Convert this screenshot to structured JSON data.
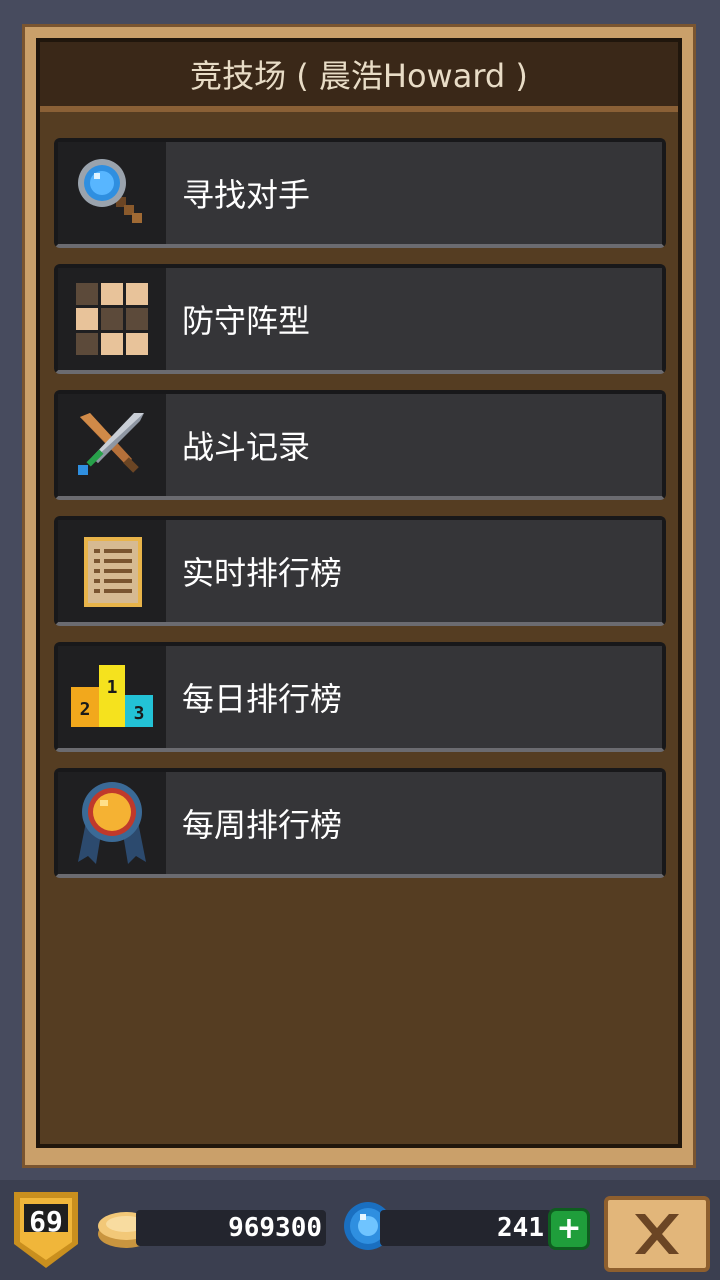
{
  "header": {
    "title": "竞技场 ( 晨浩Howard )"
  },
  "menu": {
    "items": [
      {
        "label": "寻找对手",
        "icon": "magnifier-icon"
      },
      {
        "label": "防守阵型",
        "icon": "formation-grid-icon"
      },
      {
        "label": "战斗记录",
        "icon": "crossed-swords-icon"
      },
      {
        "label": "实时排行榜",
        "icon": "list-scroll-icon"
      },
      {
        "label": "每日排行榜",
        "icon": "podium-icon"
      },
      {
        "label": "每周排行榜",
        "icon": "medal-icon"
      }
    ]
  },
  "status": {
    "level": "69",
    "gold": "969300",
    "gems": "241",
    "add_label": "+"
  },
  "colors": {
    "frame": "#caa06a",
    "panel": "#553d22",
    "button": "#353538",
    "gem": "#2f8fe0",
    "gold": "#f2c878",
    "add": "#1f9e3b"
  }
}
